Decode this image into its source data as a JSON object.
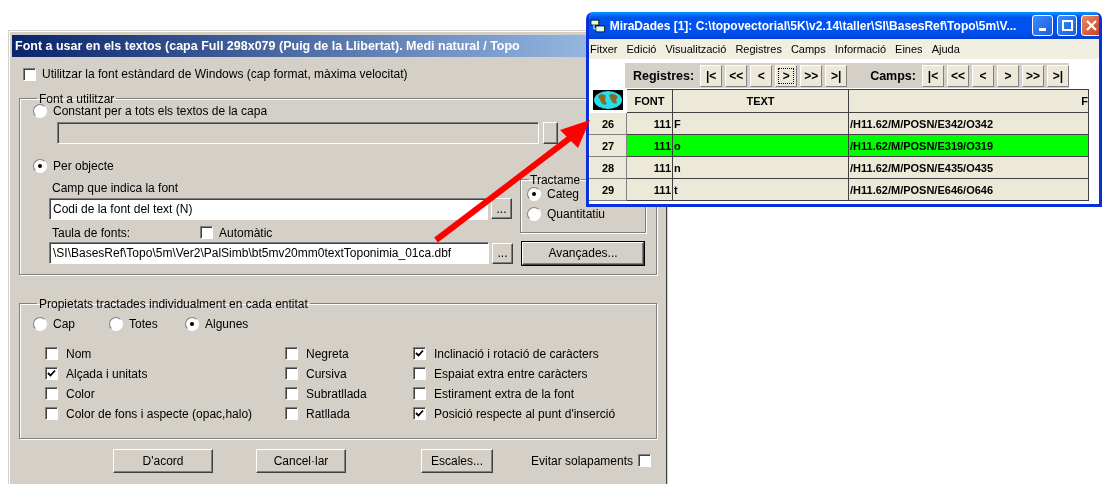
{
  "dialog": {
    "title": "Font a usar en els textos (capa Full 298x079 (Puig de la Llibertat). Medi natural / Topo",
    "standard_font": {
      "label": "Utilitzar la font estàndard de Windows (cap format, màxima velocitat)",
      "checked": false
    },
    "font_group": {
      "legend": "Font a utilitzar",
      "constant": {
        "label": "Constant per a tots els textos de la capa",
        "selected": false
      },
      "per_object": {
        "label": "Per objecte",
        "selected": true
      },
      "field_label": "Camp que indica la font",
      "field_value": "Codi de la font del text   (N)",
      "field_browse": "...",
      "table_label": "Taula de fonts:",
      "automatic": {
        "label": "Automàtic",
        "checked": false
      },
      "table_value": "\\SI\\BasesRef\\Topo\\5m\\Ver2\\PalSimb\\bt5mv20mm0textToponimia_01ca.dbf",
      "table_browse": "...",
      "advanced_button": "Avançades...",
      "treatment": {
        "legend": "Tractame",
        "options": [
          {
            "label": "Categ",
            "selected": true
          },
          {
            "label": "Quantitatiu",
            "selected": false
          }
        ]
      }
    },
    "properties_group": {
      "legend": "Propietats tractades individualment en cada entitat",
      "scope": [
        {
          "label": "Cap",
          "selected": false
        },
        {
          "label": "Totes",
          "selected": false
        },
        {
          "label": "Algunes",
          "selected": true
        }
      ],
      "columns": [
        [
          {
            "label": "Nom",
            "checked": false
          },
          {
            "label": "Alçada i unitats",
            "checked": true
          },
          {
            "label": "Color",
            "checked": false
          },
          {
            "label": "Color de fons i aspecte (opac,halo)",
            "checked": false
          }
        ],
        [
          {
            "label": "Negreta",
            "checked": false
          },
          {
            "label": "Cursiva",
            "checked": false
          },
          {
            "label": "Subratllada",
            "checked": false
          },
          {
            "label": "Ratllada",
            "checked": false
          }
        ],
        [
          {
            "label": "Inclinació i rotació de caràcters",
            "checked": true
          },
          {
            "label": "Espaiat extra entre caràcters",
            "checked": false
          },
          {
            "label": "Estirament extra de la font",
            "checked": false
          },
          {
            "label": "Posició respecte al punt d'inserció",
            "checked": true
          }
        ]
      ]
    },
    "buttons": [
      "D'acord",
      "Cancel·lar",
      "Escales..."
    ],
    "avoid_overlaps": {
      "label": "Evitar solapaments",
      "checked": false
    }
  },
  "viewer": {
    "title": "MiraDades [1]:  C:\\topovectorial\\5K\\v2.14\\taller\\SI\\BasesRef\\Topo\\5m\\V...",
    "menu": [
      "Fitxer",
      "Edició",
      "Visualització",
      "Registres",
      "Camps",
      "Informació",
      "Eines",
      "Ajuda"
    ],
    "records_label": "Registres:",
    "record_buttons": [
      {
        "label": "|<",
        "focused": false
      },
      {
        "label": "<<",
        "focused": false
      },
      {
        "label": "<",
        "focused": false
      },
      {
        "label": ">",
        "focused": true
      },
      {
        "label": ">>",
        "focused": false
      },
      {
        "label": ">|",
        "focused": false
      }
    ],
    "fields_label": "Camps:",
    "field_buttons": [
      {
        "label": "|<",
        "focused": false
      },
      {
        "label": "<<",
        "focused": false
      },
      {
        "label": "<",
        "focused": false
      },
      {
        "label": ">",
        "focused": false
      },
      {
        "label": ">>",
        "focused": false
      },
      {
        "label": ">|",
        "focused": false
      }
    ],
    "columns": [
      "FONT",
      "TEXT",
      "F"
    ],
    "rows": [
      {
        "number": "26",
        "font": "111",
        "text": "F",
        "column_3": "/H11.62/M/POSN/E342/O342",
        "selected": false
      },
      {
        "number": "27",
        "font": "111",
        "text": "o",
        "column_3": "/H11.62/M/POSN/E319/O319",
        "selected": true
      },
      {
        "number": "28",
        "font": "111",
        "text": "n",
        "column_3": "/H11.62/M/POSN/E435/O435",
        "selected": false
      },
      {
        "number": "29",
        "font": "111",
        "text": "t",
        "column_3": "/H11.62/M/POSN/E646/O646",
        "selected": false
      }
    ]
  }
}
